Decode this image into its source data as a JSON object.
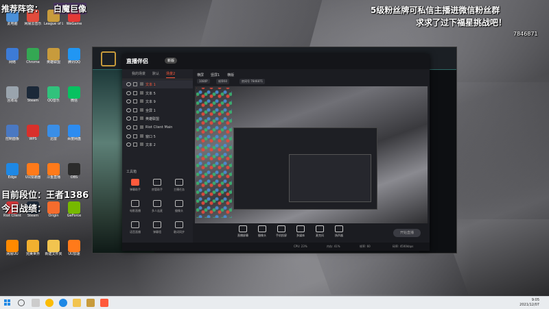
{
  "overlay": {
    "recommend": "推荐阵容：",
    "recommend_tag": "白魔巨像",
    "rank": "目前段位：王者1386",
    "today": "今日战绩：",
    "promo_line1": "5级粉丝牌可私信主播进微信粉丝群",
    "promo_line2": "求求了过下福星挑战吧！",
    "room_id": "7846871"
  },
  "desktop_icons": [
    {
      "label": "此电脑",
      "color": "#4a90d9"
    },
    {
      "label": "网易云音乐",
      "color": "#e34b3c"
    },
    {
      "label": "League of Legends",
      "color": "#c89b3c"
    },
    {
      "label": "WeGame",
      "color": "#e53935"
    },
    {
      "label": "网络",
      "color": "#3d7bd6"
    },
    {
      "label": "Chrome",
      "color": "#34a853"
    },
    {
      "label": "英雄联盟",
      "color": "#c89b3c"
    },
    {
      "label": "腾讯QQ",
      "color": "#2196f3"
    },
    {
      "label": "回收站",
      "color": "#9aa4ad"
    },
    {
      "label": "Steam",
      "color": "#1b2838"
    },
    {
      "label": "QQ音乐",
      "color": "#31c27c"
    },
    {
      "label": "微信",
      "color": "#07c160"
    },
    {
      "label": "控制面板",
      "color": "#4a78c2"
    },
    {
      "label": "WPS",
      "color": "#d9302b"
    },
    {
      "label": "迅雷",
      "color": "#3a8ee6"
    },
    {
      "label": "百度网盘",
      "color": "#2d8cf0"
    },
    {
      "label": "Edge",
      "color": "#1e88e5"
    },
    {
      "label": "UU加速器",
      "color": "#ff7a1a"
    },
    {
      "label": "斗鱼直播",
      "color": "#ff7a1a"
    },
    {
      "label": "OBS",
      "color": "#2b2b2b"
    },
    {
      "label": "Riot Client",
      "color": "#d13639"
    },
    {
      "label": "Steam",
      "color": "#1b2838"
    },
    {
      "label": "Origin",
      "color": "#f56c2d"
    },
    {
      "label": "GeForce",
      "color": "#76b900"
    },
    {
      "label": "网易UU",
      "color": "#ff8a00"
    },
    {
      "label": "完美世界",
      "color": "#f2b02f"
    },
    {
      "label": "新建文件夹",
      "color": "#f2c44f"
    },
    {
      "label": "UU加速",
      "color": "#ff7a1a"
    }
  ],
  "app": {
    "logo": "直播伴侣",
    "badge": "新版",
    "tabs": [
      "我的场景",
      "默认",
      "场景2"
    ],
    "active_tab": 2,
    "sources": [
      {
        "name": "文本 1",
        "selected": true,
        "red": true
      },
      {
        "name": "文本 5",
        "selected": false,
        "red": false
      },
      {
        "name": "文本 9",
        "selected": false,
        "red": false
      },
      {
        "name": "全屏 1",
        "selected": false,
        "red": false
      },
      {
        "name": "英雄联盟",
        "selected": false,
        "red": false
      },
      {
        "name": "Riot Client Main",
        "selected": false,
        "red": false
      },
      {
        "name": "窗口 5",
        "selected": false,
        "red": false
      },
      {
        "name": "文本 2",
        "selected": false,
        "red": false
      }
    ],
    "toolbox_title": "工具箱",
    "tools": [
      {
        "label": "弹幕助手",
        "hot": true
      },
      {
        "label": "房管助手",
        "hot": false
      },
      {
        "label": "主播任务",
        "hot": false
      },
      {
        "label": "电影直播",
        "hot": false
      },
      {
        "label": "多人连麦",
        "hot": false
      },
      {
        "label": "摄像头",
        "hot": false
      },
      {
        "label": "语音直播",
        "hot": false
      },
      {
        "label": "弹幕墙",
        "hot": false
      },
      {
        "label": "歌词同步",
        "hot": false
      }
    ],
    "segments": [
      "横屏",
      "竖屏1",
      "横版"
    ],
    "chips": [
      "1080P",
      "帧率60",
      "房间号 7846871"
    ],
    "bottom_buttons": [
      "直播屏幕",
      "摄像头",
      "手机投屏",
      "多媒体",
      "麦克风",
      "扬声器"
    ],
    "start_live": "开始直播",
    "status": [
      "CPU: 23%",
      "内存: 41%",
      "帧率: 60",
      "码率: 4500kbps"
    ]
  },
  "taskbar": {
    "time": "9:05",
    "date": "2021/12/07"
  }
}
